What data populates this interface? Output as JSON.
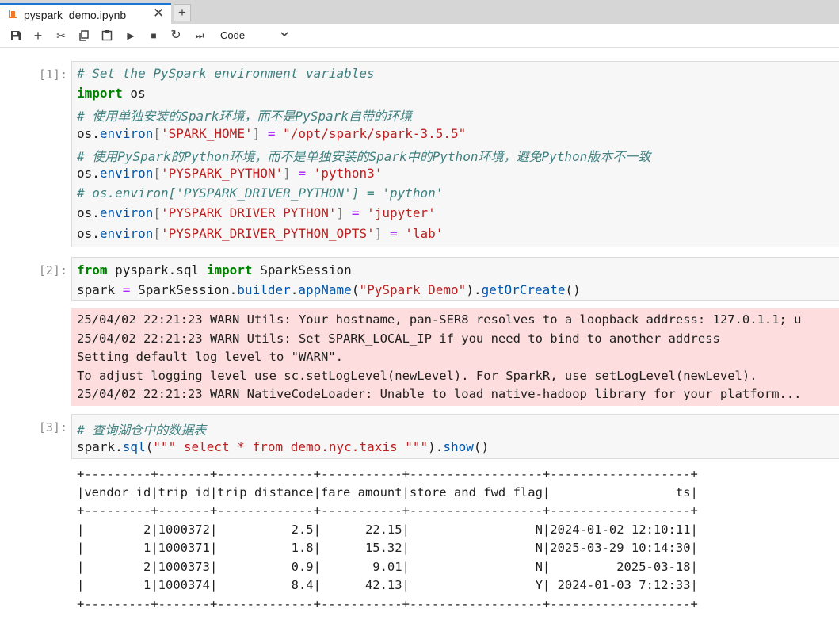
{
  "tab": {
    "title": "pyspark_demo.ipynb",
    "close": "✕",
    "new": "+"
  },
  "toolbar": {
    "save": "💾",
    "add": "+",
    "cut": "✂",
    "copy": "⧉",
    "paste": "📋",
    "run": "▶",
    "stop": "■",
    "restart": "↻",
    "run_all": "⏭",
    "cell_type": "Code"
  },
  "cells": [
    {
      "prompt": "[1]:"
    },
    {
      "prompt": "[2]:"
    },
    {
      "prompt": "[3]:"
    }
  ],
  "c1": {
    "l1": "# Set the PySpark environment variables",
    "l2a": "import",
    "l2b": " os",
    "l3": "# 使用单独安装的Spark环境，而不是PySpark自带的环境",
    "l4a": "os.",
    "l4b": "environ",
    "l4c": "[",
    "l4d": "'SPARK_HOME'",
    "l4e": "]",
    "l4f": " = ",
    "l4g": "\"/opt/spark/spark-3.5.5\"",
    "l5": "# 使用PySpark的Python环境，而不是单独安装的Spark中的Python环境，避免Python版本不一致",
    "l6a": "os.",
    "l6b": "environ",
    "l6c": "[",
    "l6d": "'PYSPARK_PYTHON'",
    "l6e": "]",
    "l6f": " = ",
    "l6g": "'python3'",
    "l7": "# os.environ['PYSPARK_DRIVER_PYTHON'] = 'python'",
    "l8a": "os.",
    "l8b": "environ",
    "l8c": "[",
    "l8d": "'PYSPARK_DRIVER_PYTHON'",
    "l8e": "]",
    "l8f": " = ",
    "l8g": "'jupyter'",
    "l9a": "os.",
    "l9b": "environ",
    "l9c": "[",
    "l9d": "'PYSPARK_DRIVER_PYTHON_OPTS'",
    "l9e": "]",
    "l9f": " = ",
    "l9g": "'lab'"
  },
  "c2": {
    "l1a": "from",
    "l1b": " pyspark.sql ",
    "l1c": "import",
    "l1d": " SparkSession",
    "l2a": "spark ",
    "l2b": "=",
    "l2c": " SparkSession.",
    "l2d": "builder",
    "l2e": ".",
    "l2f": "appName",
    "l2g": "(",
    "l2h": "\"PySpark Demo\"",
    "l2i": ").",
    "l2j": "getOrCreate",
    "l2k": "()"
  },
  "stderr": [
    "25/04/02 22:21:23 WARN Utils: Your hostname, pan-SER8 resolves to a loopback address: 127.0.1.1; u",
    "25/04/02 22:21:23 WARN Utils: Set SPARK_LOCAL_IP if you need to bind to another address",
    "Setting default log level to \"WARN\".",
    "To adjust logging level use sc.setLogLevel(newLevel). For SparkR, use setLogLevel(newLevel).",
    "25/04/02 22:21:23 WARN NativeCodeLoader: Unable to load native-hadoop library for your platform..."
  ],
  "c3": {
    "l1": "# 查询湖仓中的数据表",
    "l2a": "spark.",
    "l2b": "sql",
    "l2c": "(",
    "l2d": "\"\"\" select * from demo.nyc.taxis \"\"\"",
    "l2e": ").",
    "l2f": "show",
    "l2g": "()"
  },
  "table_out": [
    "+---------+-------+-------------+-----------+------------------+-------------------+",
    "|vendor_id|trip_id|trip_distance|fare_amount|store_and_fwd_flag|                 ts|",
    "+---------+-------+-------------+-----------+------------------+-------------------+",
    "|        2|1000372|          2.5|      22.15|                 N|2024-01-02 12:10:11|",
    "|        1|1000371|          1.8|      15.32|                 N|2025-03-29 10:14:30|",
    "|        2|1000373|          0.9|       9.01|                 N|         2025-03-18|",
    "|        1|1000374|          8.4|      42.13|                 Y| 2024-01-03 7:12:33|",
    "+---------+-------+-------------+-----------+------------------+-------------------+"
  ]
}
